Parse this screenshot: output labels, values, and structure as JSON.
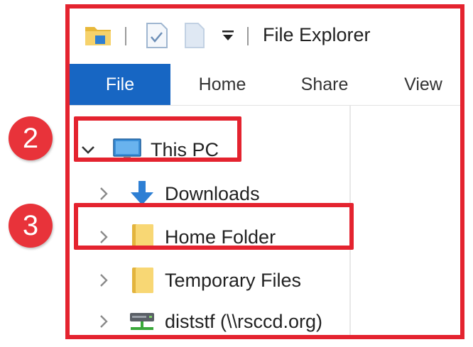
{
  "window": {
    "title": "File Explorer",
    "quick_access_icons": [
      "folder-icon",
      "properties-icon",
      "new-folder-icon",
      "customize-dropdown-icon"
    ]
  },
  "ribbon": {
    "tabs": [
      {
        "label": "File",
        "active": true
      },
      {
        "label": "Home",
        "active": false
      },
      {
        "label": "Share",
        "active": false
      },
      {
        "label": "View",
        "active": false
      }
    ],
    "active_color": "#1766c3"
  },
  "nav_tree": {
    "root": {
      "label": "This PC",
      "expanded": true,
      "icon": "monitor-icon"
    },
    "items": [
      {
        "label": "Downloads",
        "icon": "download-arrow-icon"
      },
      {
        "label": "Home Folder",
        "icon": "folder-icon"
      },
      {
        "label": "Temporary Files",
        "icon": "folder-icon"
      },
      {
        "label": "diststf (\\\\rsccd.org)",
        "icon": "network-drive-icon"
      }
    ]
  },
  "annotations": {
    "step_2": "2",
    "step_3": "3",
    "highlight_color": "#e4232f"
  }
}
